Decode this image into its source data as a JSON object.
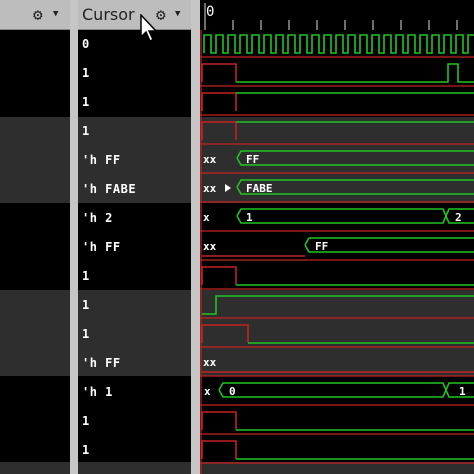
{
  "header": {
    "value_column_title": "Cursor",
    "name_settings_icon": "gear-icon",
    "value_settings_icon": "gear-icon",
    "ruler_time": "0"
  },
  "colors": {
    "band_dark": "#000000",
    "band_light": "#2e2e2e",
    "signal_green": "#22c422",
    "signal_red": "#c22222",
    "column_header": "#bdbdbd"
  },
  "rows": [
    {
      "value": "0",
      "wave_label": ""
    },
    {
      "value": "1",
      "wave_label": ""
    },
    {
      "value": "1",
      "wave_label": ""
    },
    {
      "value": "1",
      "wave_label": ""
    },
    {
      "value": "'h FF",
      "wave_label": "xx",
      "wave_label2": "FF"
    },
    {
      "value": "'h FABE",
      "wave_label": "xx",
      "wave_label2": "FABE"
    },
    {
      "value": "'h 2",
      "wave_label": "x",
      "wave_label2": "1",
      "wave_label3": "2"
    },
    {
      "value": "'h FF",
      "wave_label": "xx",
      "wave_label2": "FF"
    },
    {
      "value": "1",
      "wave_label": ""
    },
    {
      "value": "1",
      "wave_label": ""
    },
    {
      "value": "1",
      "wave_label": ""
    },
    {
      "value": "'h FF",
      "wave_label": "xx"
    },
    {
      "value": "'h 1",
      "wave_label": "x",
      "wave_label2": "0",
      "wave_label3": "1"
    },
    {
      "value": "1",
      "wave_label": ""
    },
    {
      "value": "1",
      "wave_label": ""
    }
  ]
}
